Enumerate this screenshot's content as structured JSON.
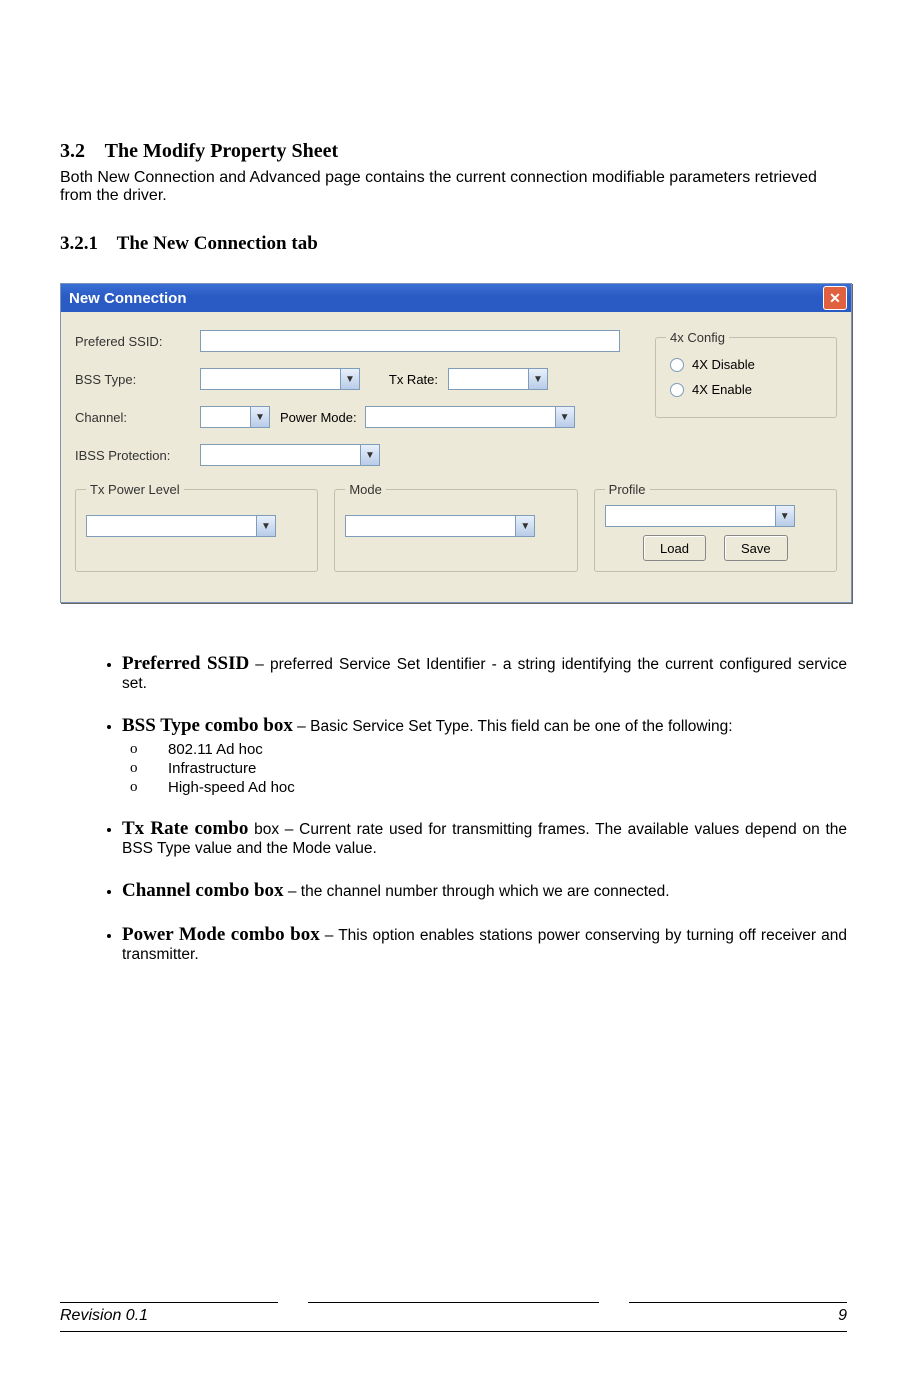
{
  "section": {
    "num": "3.2",
    "title": "The Modify Property Sheet",
    "intro": "Both New Connection and Advanced page contains the current connection modifiable parameters retrieved from the driver."
  },
  "subsection": {
    "num": "3.2.1",
    "title": "The New Connection tab"
  },
  "dialog": {
    "title": "New Connection",
    "labels": {
      "ssid": "Prefered SSID:",
      "bss": "BSS Type:",
      "txrate": "Tx Rate:",
      "channel": "Channel:",
      "power": "Power Mode:",
      "ibss": "IBSS Protection:"
    },
    "fourx": {
      "legend": "4x Config",
      "disable": "4X Disable",
      "enable": "4X Enable"
    },
    "groups": {
      "txpower": "Tx Power Level",
      "mode": "Mode",
      "profile": "Profile"
    },
    "buttons": {
      "load": "Load",
      "save": "Save"
    }
  },
  "features": [
    {
      "term": "Preferred SSID",
      "desc": " – preferred Service Set Identifier - a string identifying the current configured service set."
    },
    {
      "term": "BSS Type combo box",
      "desc": " – Basic Service Set Type. This field can be one of the following:",
      "sub": [
        "802.11 Ad hoc",
        "Infrastructure",
        "High-speed Ad hoc"
      ]
    },
    {
      "term": "Tx Rate combo",
      "desc": " box – Current rate used for transmitting frames. The available values depend on the BSS Type value and the Mode value."
    },
    {
      "term": "Channel combo box",
      "desc": "  – the channel number through which we are connected."
    },
    {
      "term": "Power Mode combo box",
      "desc": " – This option enables stations power conserving by turning off receiver and transmitter."
    }
  ],
  "footer": {
    "revision": "Revision 0.1",
    "page": "9"
  }
}
